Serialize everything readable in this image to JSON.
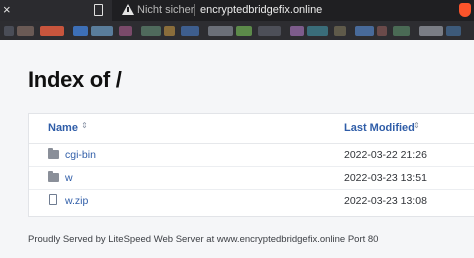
{
  "browser": {
    "security_label": "Nicht sicher",
    "url": "encryptedbridgefix.online",
    "tab_close_glyph": "×",
    "icons": [
      "close-icon",
      "bookmark-icon",
      "warning-icon",
      "brave-shield-icon"
    ],
    "bookmark_blob_colors": [
      "#4a4d57",
      "#6a5a55",
      "#c8553d",
      "#3d6fb6",
      "#5a7d9b",
      "#7a4a6a",
      "#4f6a5c",
      "#8a6d3b",
      "#3e5e8e",
      "#6b6f78",
      "#5c8a4a",
      "#4d4f58",
      "#7d5c8c",
      "#3a6d7a",
      "#5f5a4a",
      "#486a9a",
      "#6a4a4a",
      "#4a6a55",
      "#7a7d85",
      "#3d5a7a"
    ]
  },
  "page": {
    "title": "Index of /",
    "columns": {
      "name": "Name",
      "last_modified": "Last Modified",
      "sort_glyph": "⇕"
    },
    "rows": [
      {
        "name": "cgi-bin",
        "modified": "2022-03-22 21:26",
        "type": "folder"
      },
      {
        "name": "w",
        "modified": "2022-03-23 13:51",
        "type": "folder"
      },
      {
        "name": "w.zip",
        "modified": "2022-03-23 13:08",
        "type": "file"
      }
    ],
    "footer": "Proudly Served by LiteSpeed Web Server at www.encryptedbridgefix.online Port 80"
  },
  "colors": {
    "link": "#2f5da8",
    "page_bg": "#f5f6f8",
    "chrome_bg": "#2b2b2f"
  }
}
